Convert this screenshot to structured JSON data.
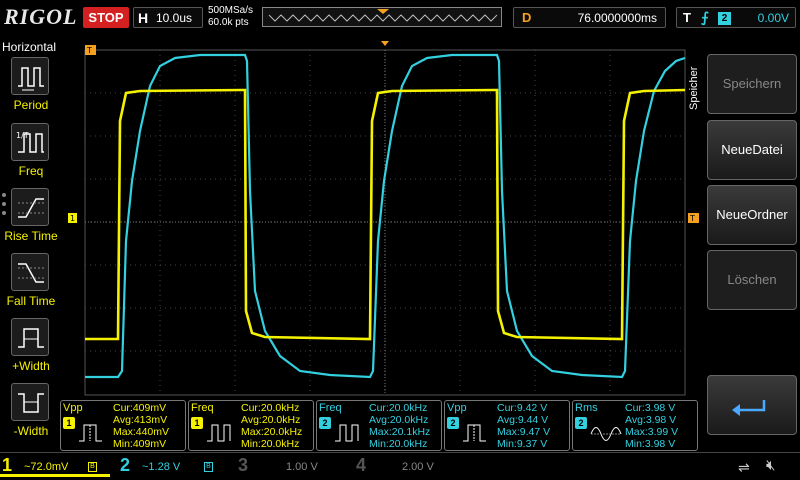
{
  "brand": "RIGOL",
  "run_status": "STOP",
  "horizontal": {
    "key": "H",
    "timebase": "10.0us",
    "sample_rate": "500MSa/s",
    "points": "60.0k pts"
  },
  "delay": {
    "key": "D",
    "value": "76.0000000ms"
  },
  "trigger": {
    "key": "T",
    "edge_icon": "rising-edge-icon",
    "source": "2",
    "level": "0.00V"
  },
  "left_menu": {
    "title": "Horizontal",
    "items": [
      {
        "label": "Period",
        "icon": "period-icon"
      },
      {
        "label": "Freq",
        "icon": "frequency-icon"
      },
      {
        "label": "Rise Time",
        "icon": "rise-time-icon"
      },
      {
        "label": "Fall Time",
        "icon": "fall-time-icon"
      },
      {
        "label": "+Width",
        "icon": "positive-width-icon"
      },
      {
        "label": "-Width",
        "icon": "negative-width-icon"
      }
    ]
  },
  "right_menu": {
    "title": "Speicher",
    "buttons": [
      {
        "label": "Speichern",
        "enabled": false
      },
      {
        "label": "NeueDatei",
        "enabled": true
      },
      {
        "label": "NeueOrdner",
        "enabled": true
      },
      {
        "label": "Löschen",
        "enabled": false
      },
      {
        "label": "",
        "icon": "return-arrow-icon",
        "enabled": true
      }
    ]
  },
  "markers": {
    "trigger_pos": "T",
    "ch1_level": "1",
    "trigger_level": "T"
  },
  "measurements": [
    {
      "name": "Vpp",
      "channel": "1",
      "cur": "Cur:409mV",
      "avg": "Avg:413mV",
      "max": "Max:440mV",
      "min": "Min:409mV"
    },
    {
      "name": "Freq",
      "channel": "1",
      "cur": "Cur:20.0kHz",
      "avg": "Avg:20.0kHz",
      "max": "Max:20.0kHz",
      "min": "Min:20.0kHz"
    },
    {
      "name": "Freq",
      "channel": "2",
      "cur": "Cur:20.0kHz",
      "avg": "Avg:20.0kHz",
      "max": "Max:20.1kHz",
      "min": "Min:20.0kHz"
    },
    {
      "name": "Vpp",
      "channel": "2",
      "cur": "Cur:9.42 V",
      "avg": "Avg:9.44 V",
      "max": "Max:9.47 V",
      "min": "Min:9.37 V"
    },
    {
      "name": "Rms",
      "channel": "2",
      "cur": "Cur:3.98 V",
      "avg": "Avg:3.98 V",
      "max": "Max:3.99 V",
      "min": "Min:3.98 V"
    }
  ],
  "channels": [
    {
      "num": "1",
      "scale": "~72.0mV",
      "color": "#f5f200",
      "active": true
    },
    {
      "num": "2",
      "scale": "~1.28 V",
      "color": "#33d0e0",
      "active": true
    },
    {
      "num": "3",
      "scale": "1.00 V",
      "color": "#c050c0",
      "active": false
    },
    {
      "num": "4",
      "scale": "2.00 V",
      "color": "#3070e0",
      "active": false
    }
  ],
  "colors": {
    "ch1": "#f5f200",
    "ch2": "#33d0e0",
    "accent": "#f5a020",
    "stop": "#d42020"
  }
}
